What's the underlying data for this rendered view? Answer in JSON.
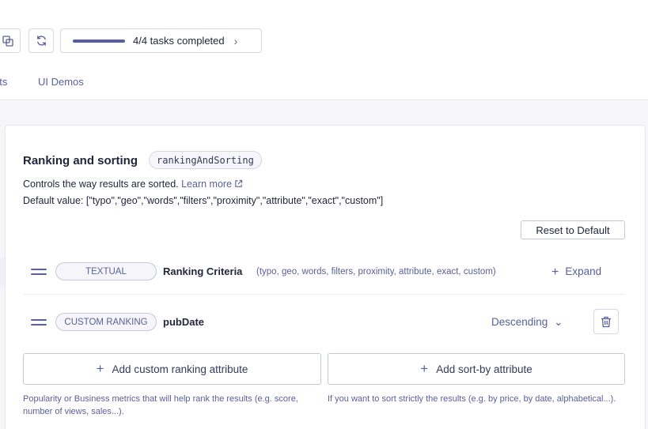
{
  "toolbar": {
    "tasks_label": "4/4 tasks completed",
    "tasks_progress": 1.0
  },
  "tabs": [
    {
      "label": "ats"
    },
    {
      "label": "UI Demos"
    }
  ],
  "section": {
    "title": "Ranking and sorting",
    "code": "rankingAndSorting",
    "description": "Controls the way results are sorted.",
    "learn_more": "Learn more",
    "default_value": "Default value: [\"typo\",\"geo\",\"words\",\"filters\",\"proximity\",\"attribute\",\"exact\",\"custom\"]",
    "reset_label": "Reset to Default"
  },
  "rows": [
    {
      "badge": "TEXTUAL",
      "name": "Ranking Criteria",
      "sub": "(typo, geo, words, filters, proximity, attribute, exact, custom)",
      "action": "Expand"
    },
    {
      "badge": "CUSTOM RANKING",
      "name": "pubDate",
      "sort": "Descending"
    }
  ],
  "add_buttons": {
    "custom": "Add custom ranking attribute",
    "sortby": "Add sort-by attribute"
  },
  "help": {
    "custom": "Popularity or Business metrics that will help rank the results (e.g. score, number of views, sales...).",
    "sortby": "If you want to sort strictly the results (e.g. by price, by date, alphabetical...)."
  },
  "colors": {
    "accent": "#5a5e9a",
    "text": "#23263b",
    "border": "#d6d6e7",
    "background": "#f5f5fa"
  }
}
